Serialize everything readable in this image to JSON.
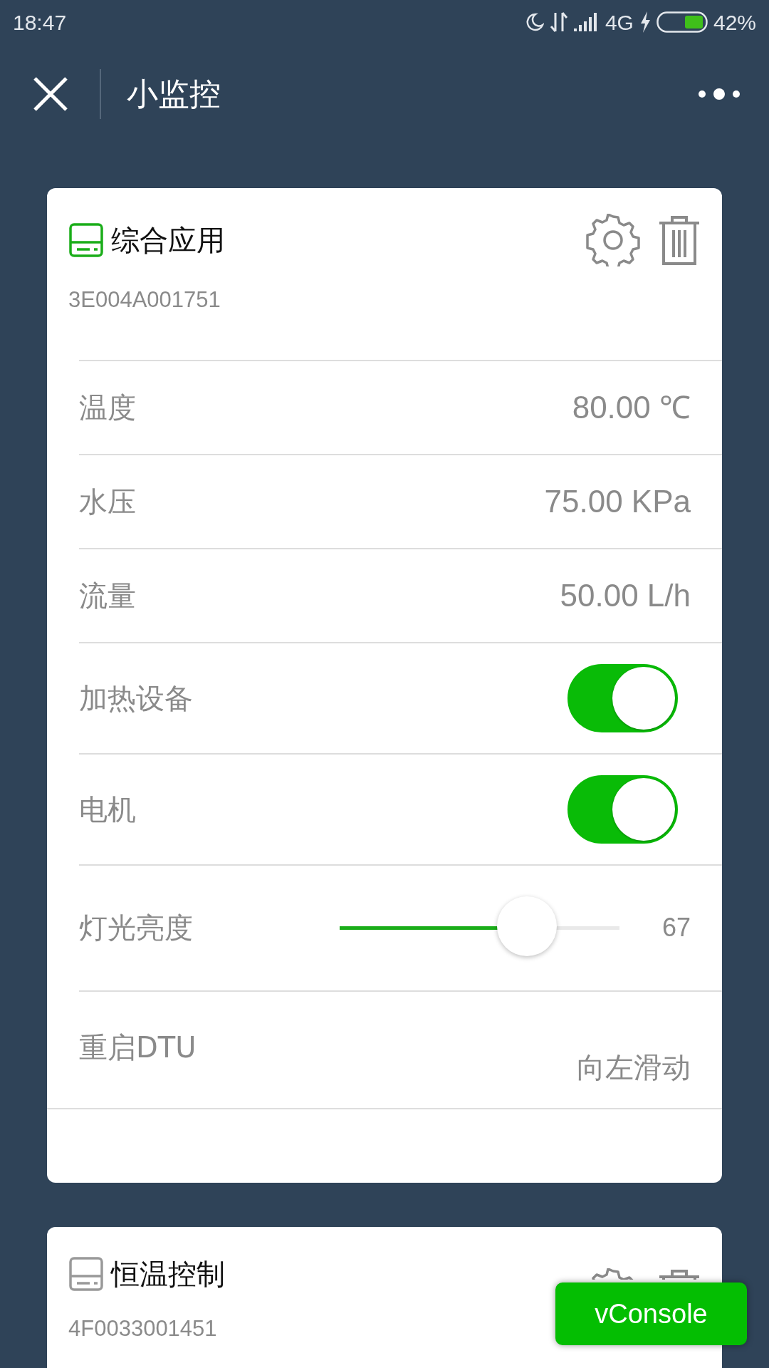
{
  "status_bar": {
    "time": "18:47",
    "network": "4G",
    "battery": "42%"
  },
  "nav": {
    "title": "小监控"
  },
  "devices": [
    {
      "name": "综合应用",
      "id": "3E004A001751",
      "online": true,
      "rows": [
        {
          "kind": "reading",
          "label": "温度",
          "value": "80.00 ℃"
        },
        {
          "kind": "reading",
          "label": "水压",
          "value": "75.00 KPa"
        },
        {
          "kind": "reading",
          "label": "流量",
          "value": "50.00 L/h"
        },
        {
          "kind": "switch",
          "label": "加热设备",
          "on": true
        },
        {
          "kind": "switch",
          "label": "电机",
          "on": true
        },
        {
          "kind": "slider",
          "label": "灯光亮度",
          "level": 0.67,
          "reading": "67"
        },
        {
          "kind": "swipe",
          "label": "重启DTU",
          "hint": "向左滑动"
        }
      ]
    },
    {
      "name": "恒温控制",
      "id": "4F0033001451",
      "online": false
    }
  ],
  "vconsole": "vConsole"
}
